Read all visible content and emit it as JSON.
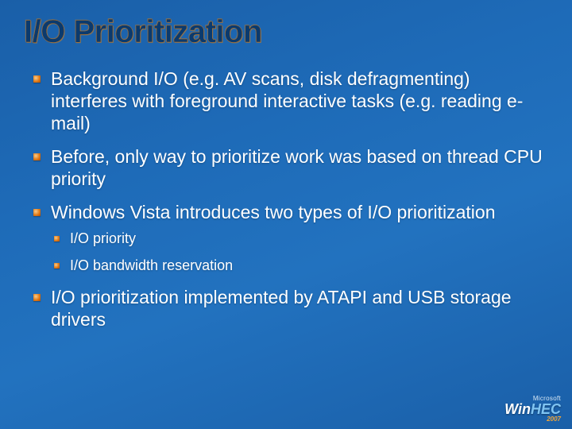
{
  "title": "I/O Prioritization",
  "bullets": {
    "b1": "Background I/O (e.g. AV scans, disk defragmenting) interferes with foreground interactive tasks\n(e.g. reading e-mail)",
    "b2": "Before, only way to prioritize work was based on thread CPU priority",
    "b3": "Windows Vista introduces two types of I/O prioritization",
    "b4": "I/O prioritization implemented by ATAPI and USB storage drivers"
  },
  "sub": {
    "s1": "I/O priority",
    "s2": "I/O bandwidth reservation"
  },
  "footer": {
    "vendor": "Microsoft",
    "brand_a": "Win",
    "brand_b": "HEC",
    "year": "2007"
  }
}
